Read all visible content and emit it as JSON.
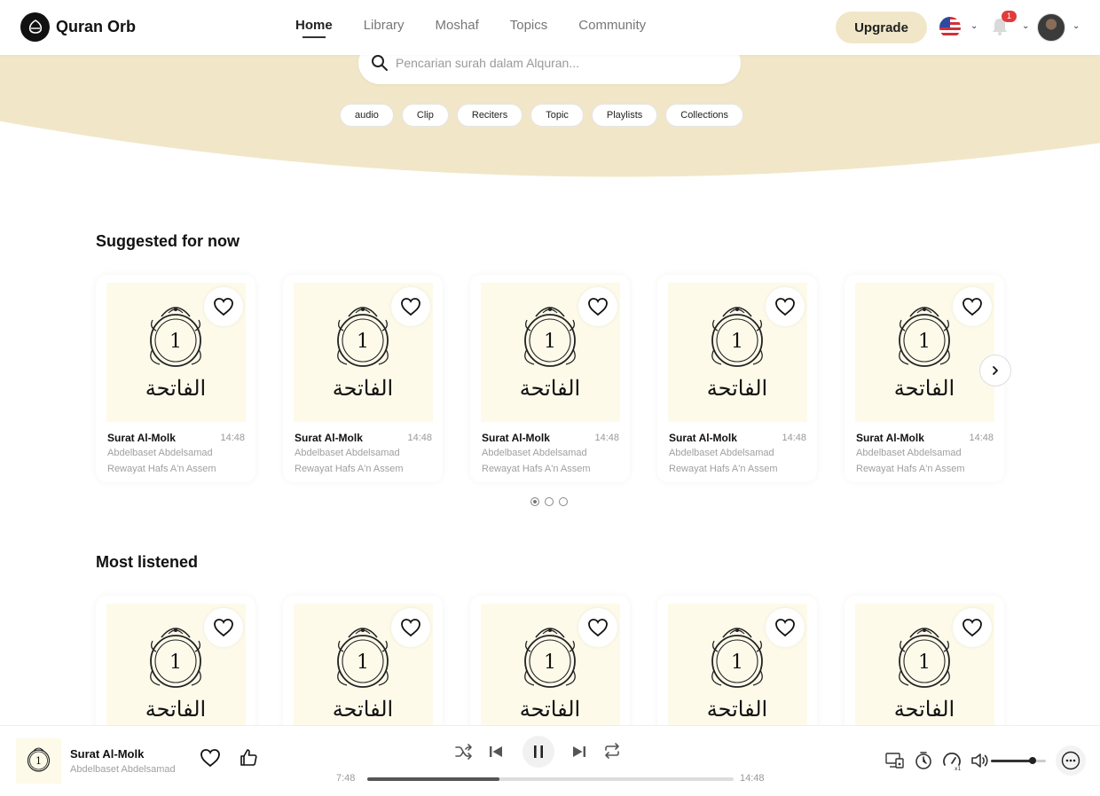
{
  "app": {
    "name": "Quran Orb"
  },
  "nav": {
    "items": [
      {
        "label": "Home",
        "active": true
      },
      {
        "label": "Library",
        "active": false
      },
      {
        "label": "Moshaf",
        "active": false
      },
      {
        "label": "Topics",
        "active": false
      },
      {
        "label": "Community",
        "active": false
      }
    ],
    "upgrade_label": "Upgrade",
    "notification_count": "1"
  },
  "search": {
    "placeholder": "Pencarian surah dalam Alquran..."
  },
  "filters": [
    "audio",
    "Clip",
    "Reciters",
    "Topic",
    "Playlists",
    "Collections"
  ],
  "sections": [
    {
      "title": "Suggested for now",
      "cards": [
        {
          "number": "1",
          "arabic": "الفاتحة",
          "title": "Surat Al-Molk",
          "duration": "14:48",
          "reciter": "Abdelbaset Abdelsamad",
          "riwaya": "Rewayat Hafs A'n Assem"
        },
        {
          "number": "1",
          "arabic": "الفاتحة",
          "title": "Surat Al-Molk",
          "duration": "14:48",
          "reciter": "Abdelbaset Abdelsamad",
          "riwaya": "Rewayat Hafs A'n Assem"
        },
        {
          "number": "1",
          "arabic": "الفاتحة",
          "title": "Surat Al-Molk",
          "duration": "14:48",
          "reciter": "Abdelbaset Abdelsamad",
          "riwaya": "Rewayat Hafs A'n Assem"
        },
        {
          "number": "1",
          "arabic": "الفاتحة",
          "title": "Surat Al-Molk",
          "duration": "14:48",
          "reciter": "Abdelbaset Abdelsamad",
          "riwaya": "Rewayat Hafs A'n Assem"
        },
        {
          "number": "1",
          "arabic": "الفاتحة",
          "title": "Surat Al-Molk",
          "duration": "14:48",
          "reciter": "Abdelbaset Abdelsamad",
          "riwaya": "Rewayat Hafs A'n Assem"
        }
      ],
      "pagination": {
        "pages": 3,
        "current": 1
      }
    },
    {
      "title": "Most listened",
      "cards": [
        {
          "number": "1",
          "arabic": "الفاتحة"
        },
        {
          "number": "1",
          "arabic": "الفاتحة"
        },
        {
          "number": "1",
          "arabic": "الفاتحة"
        },
        {
          "number": "1",
          "arabic": "الفاتحة"
        },
        {
          "number": "1",
          "arabic": "الفاتحة"
        }
      ]
    }
  ],
  "player": {
    "cover_number": "1",
    "title": "Surat Al-Molk",
    "artist": "Abdelbaset Abdelsamad",
    "elapsed": "7:48",
    "total": "14:48",
    "progress": 0.36,
    "volume": 0.75
  },
  "colors": {
    "hero": "#f1e7c8",
    "cover": "#fdfaea",
    "badge": "#e23b3b"
  }
}
